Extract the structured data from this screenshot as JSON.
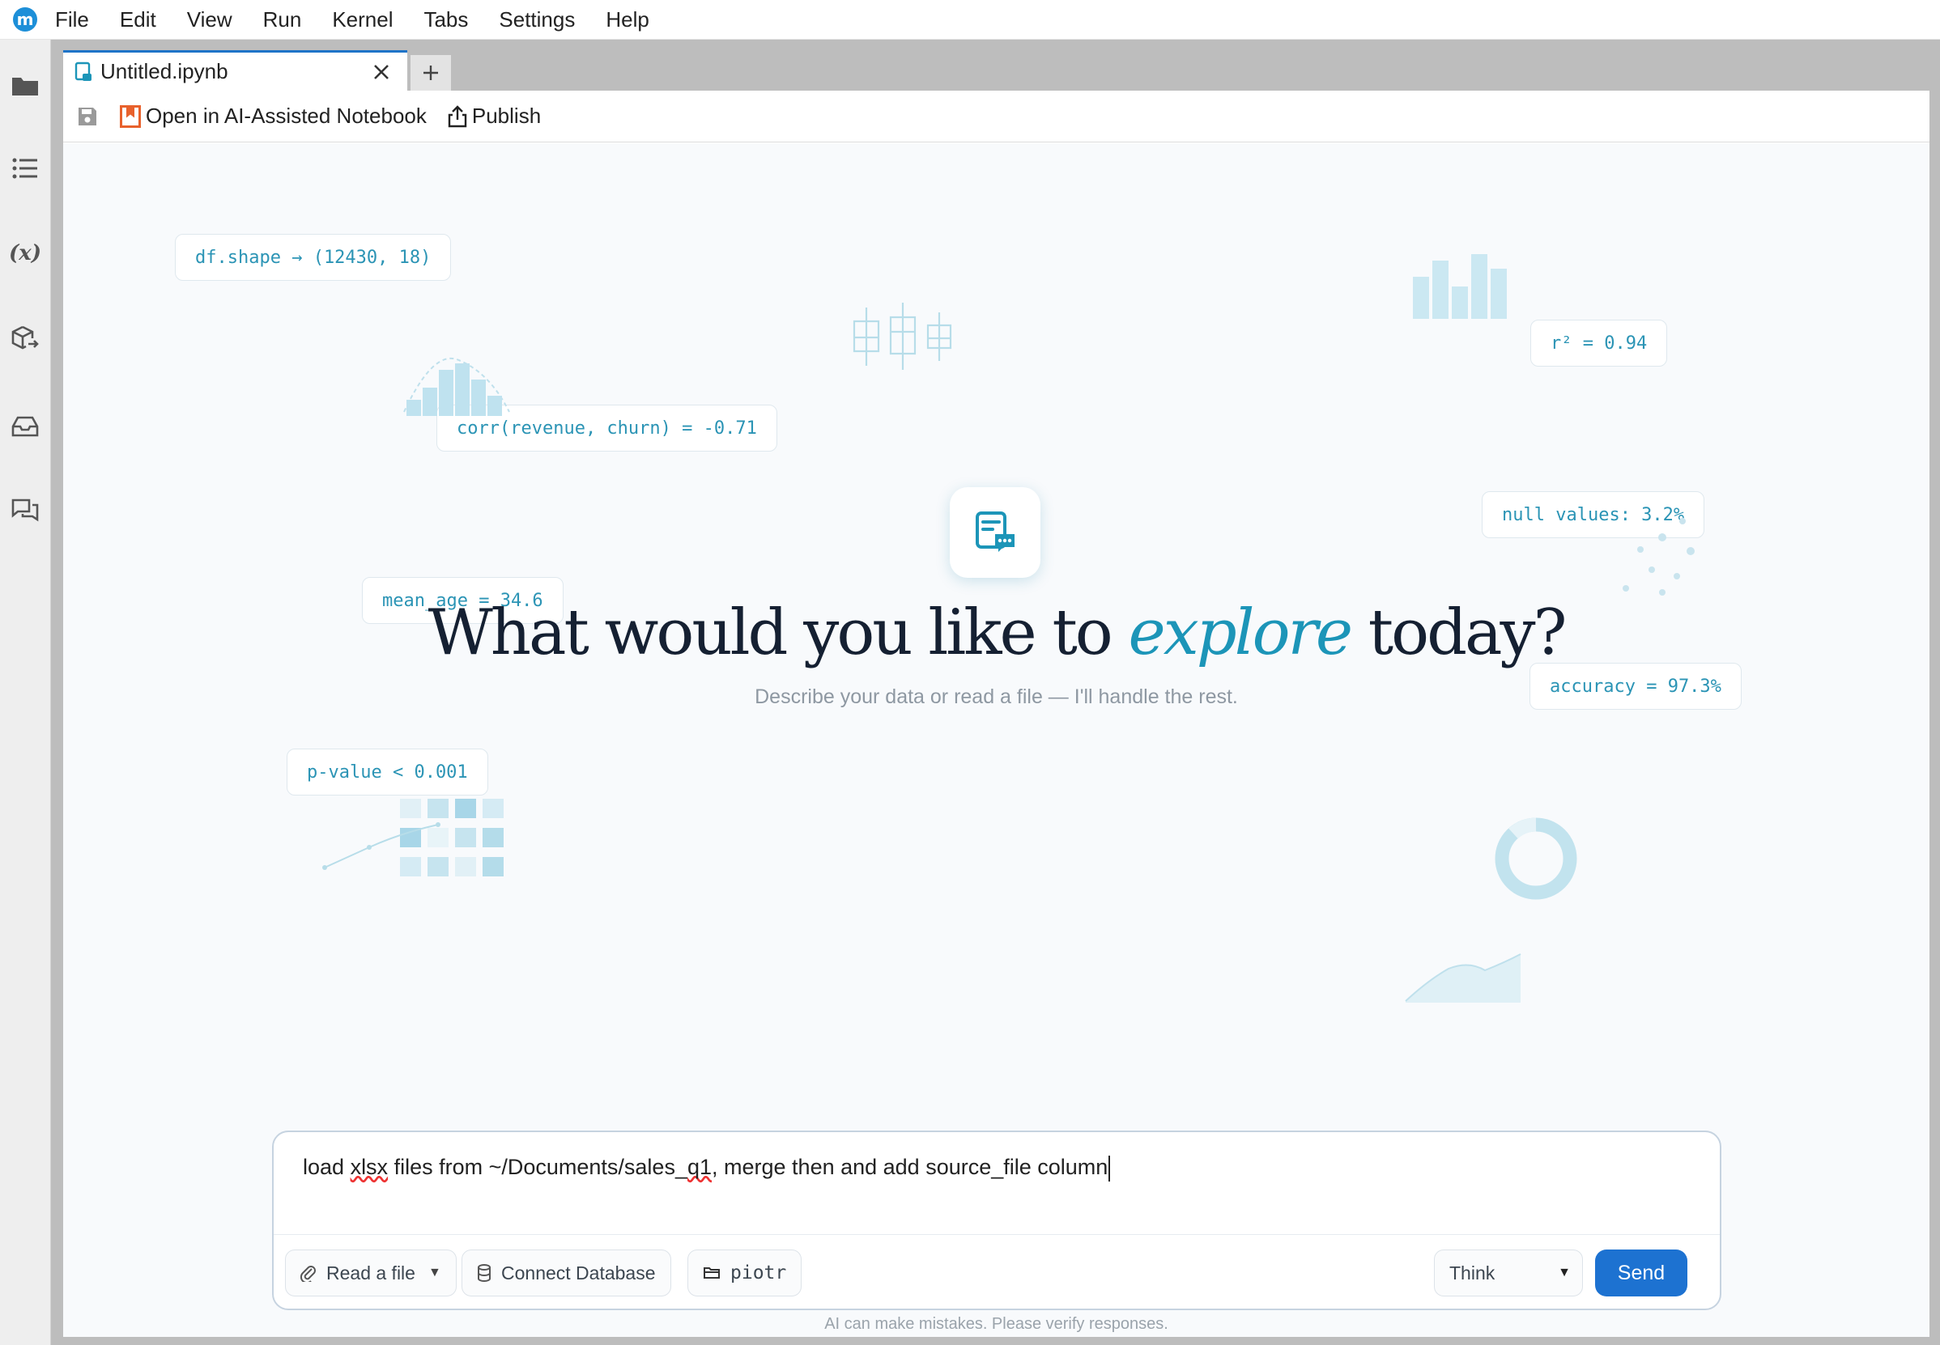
{
  "app": {
    "logo_letter": "m",
    "menu": [
      "File",
      "Edit",
      "View",
      "Run",
      "Kernel",
      "Tabs",
      "Settings",
      "Help"
    ]
  },
  "sidebar": {
    "icons": [
      "folder-icon",
      "list-icon",
      "variable-icon",
      "package-icon",
      "inbox-icon",
      "chat-icon"
    ],
    "variable_glyph": "(x)"
  },
  "tabs": {
    "active_label": "Untitled.ipynb",
    "add_glyph": "+"
  },
  "toolbar": {
    "open_ai_label": "Open in AI-Assisted Notebook",
    "publish_label": "Publish"
  },
  "chips": {
    "df_shape": "df.shape → (12430, 18)",
    "corr": "corr(revenue, churn) = -0.71",
    "r2": "r² = 0.94",
    "null_values": "null values: 3.2%",
    "mean_age": "mean_age = 34.6",
    "accuracy": "accuracy = 97.3%",
    "pvalue": "p-value < 0.001"
  },
  "hero": {
    "headline_pre": "What would you like to ",
    "headline_em": "explore",
    "headline_post": " today?",
    "subline": "Describe your data or read a file — I'll handle the rest."
  },
  "composer": {
    "prompt_part1": "load ",
    "prompt_sq1": "xlsx",
    "prompt_part2": " files from ~/Documents/sales_",
    "prompt_sq2": "q1",
    "prompt_part3": ", merge then and add source_file column",
    "read_file_label": "Read a file",
    "connect_db_label": "Connect Database",
    "folder_label": "piotr",
    "mode_selected": "Think",
    "send_label": "Send"
  },
  "footer": {
    "disclaimer": "AI can make mistakes. Please verify responses."
  },
  "colors": {
    "accent": "#1c95b8",
    "send": "#1d72d1",
    "tab_top": "#1e74c8"
  }
}
